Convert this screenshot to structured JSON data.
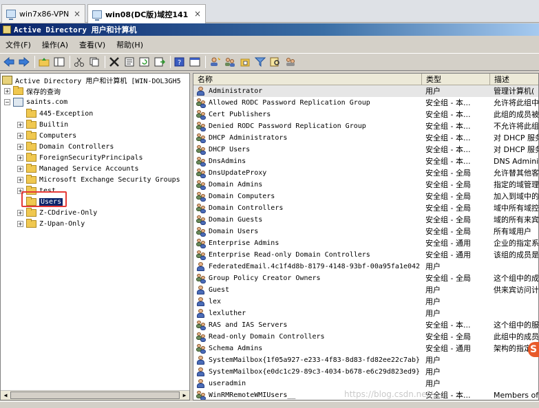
{
  "vm_tabs": [
    {
      "label": "win7x86-VPN",
      "close": "×",
      "active": false
    },
    {
      "label": "win08(DC版)域控141",
      "close": "×",
      "active": true
    }
  ],
  "window": {
    "title": "Active Directory 用户和计算机"
  },
  "menu": [
    "文件(F)",
    "操作(A)",
    "查看(V)",
    "帮助(H)"
  ],
  "toolbar_icons": [
    "back-icon",
    "forward-icon",
    "up-folder-icon",
    "show-tree-icon",
    "cut-icon",
    "copy-icon",
    "delete-icon",
    "properties-icon",
    "refresh-icon",
    "export-icon",
    "help-icon",
    "console-icon",
    "new-user-icon",
    "new-group-icon",
    "new-ou-icon",
    "filter-icon",
    "find-icon",
    "add-to-group-icon"
  ],
  "tree": {
    "root": "Active Directory 用户和计算机 [WIN-DOL3GH5",
    "saved_queries": "保存的查询",
    "domain": "saints.com",
    "children": [
      {
        "label": "445-Exception",
        "has_expander": false
      },
      {
        "label": "Builtin",
        "has_expander": true
      },
      {
        "label": "Computers",
        "has_expander": true
      },
      {
        "label": "Domain Controllers",
        "has_expander": true
      },
      {
        "label": "ForeignSecurityPrincipals",
        "has_expander": true
      },
      {
        "label": "Managed Service Accounts",
        "has_expander": true
      },
      {
        "label": "Microsoft Exchange Security Groups",
        "has_expander": true
      },
      {
        "label": "test",
        "has_expander": true
      },
      {
        "label": "Users",
        "has_expander": false,
        "selected": true
      },
      {
        "label": "Z-CDdrive-Only",
        "has_expander": true
      },
      {
        "label": "Z-Upan-Only",
        "has_expander": true
      }
    ]
  },
  "list": {
    "columns": [
      "名称",
      "类型",
      "描述"
    ],
    "rows": [
      {
        "name": "Administrator",
        "type": "用户",
        "desc": "管理计算机(",
        "icon": "user",
        "selected": true
      },
      {
        "name": "Allowed RODC Password Replication Group",
        "type": "安全组 - 本...",
        "desc": "允许将此组中",
        "icon": "group"
      },
      {
        "name": "Cert Publishers",
        "type": "安全组 - 本...",
        "desc": "此组的成员被",
        "icon": "group"
      },
      {
        "name": "Denied RODC Password Replication Group",
        "type": "安全组 - 本...",
        "desc": "不允许将此组",
        "icon": "group"
      },
      {
        "name": "DHCP Administrators",
        "type": "安全组 - 本...",
        "desc": "对 DHCP 服务",
        "icon": "group"
      },
      {
        "name": "DHCP Users",
        "type": "安全组 - 本...",
        "desc": "对 DHCP 服务",
        "icon": "group"
      },
      {
        "name": "DnsAdmins",
        "type": "安全组 - 本...",
        "desc": "DNS Adminis",
        "icon": "group"
      },
      {
        "name": "DnsUpdateProxy",
        "type": "安全组 - 全局",
        "desc": "允许替其他客",
        "icon": "group"
      },
      {
        "name": "Domain Admins",
        "type": "安全组 - 全局",
        "desc": "指定的域管理",
        "icon": "group"
      },
      {
        "name": "Domain Computers",
        "type": "安全组 - 全局",
        "desc": "加入到域中的",
        "icon": "group"
      },
      {
        "name": "Domain Controllers",
        "type": "安全组 - 全局",
        "desc": "域中所有域控",
        "icon": "group"
      },
      {
        "name": "Domain Guests",
        "type": "安全组 - 全局",
        "desc": "域的所有来宾",
        "icon": "group"
      },
      {
        "name": "Domain Users",
        "type": "安全组 - 全局",
        "desc": "所有域用户",
        "icon": "group"
      },
      {
        "name": "Enterprise Admins",
        "type": "安全组 - 通用",
        "desc": "企业的指定系",
        "icon": "group"
      },
      {
        "name": "Enterprise Read-only Domain Controllers",
        "type": "安全组 - 通用",
        "desc": "该组的成员是",
        "icon": "group"
      },
      {
        "name": "FederatedEmail.4c1f4d8b-8179-4148-93bf-00a95fa1e042",
        "type": "用户",
        "desc": "",
        "icon": "user"
      },
      {
        "name": "Group Policy Creator Owners",
        "type": "安全组 - 全局",
        "desc": "这个组中的成",
        "icon": "group"
      },
      {
        "name": "Guest",
        "type": "用户",
        "desc": "供来宾访问计",
        "icon": "user"
      },
      {
        "name": "lex",
        "type": "用户",
        "desc": "",
        "icon": "user"
      },
      {
        "name": "lexluther",
        "type": "用户",
        "desc": "",
        "icon": "user"
      },
      {
        "name": "RAS and IAS Servers",
        "type": "安全组 - 本...",
        "desc": "这个组中的服",
        "icon": "group"
      },
      {
        "name": "Read-only Domain Controllers",
        "type": "安全组 - 全局",
        "desc": "此组中的成员",
        "icon": "group"
      },
      {
        "name": "Schema Admins",
        "type": "安全组 - 通用",
        "desc": "架构的指定系",
        "icon": "group"
      },
      {
        "name": "SystemMailbox{1f05a927-e233-4f83-8d83-fd82ee22c7ab}",
        "type": "用户",
        "desc": "",
        "icon": "user"
      },
      {
        "name": "SystemMailbox{e0dc1c29-89c3-4034-b678-e6c29d823ed9}",
        "type": "用户",
        "desc": "",
        "icon": "user"
      },
      {
        "name": "useradmin",
        "type": "用户",
        "desc": "",
        "icon": "user"
      },
      {
        "name": "WinRMRemoteWMIUsers__",
        "type": "安全组 - 本...",
        "desc": "Members of",
        "icon": "group"
      }
    ]
  },
  "watermark": "https://blog.csdn.net/...",
  "badge": "S"
}
